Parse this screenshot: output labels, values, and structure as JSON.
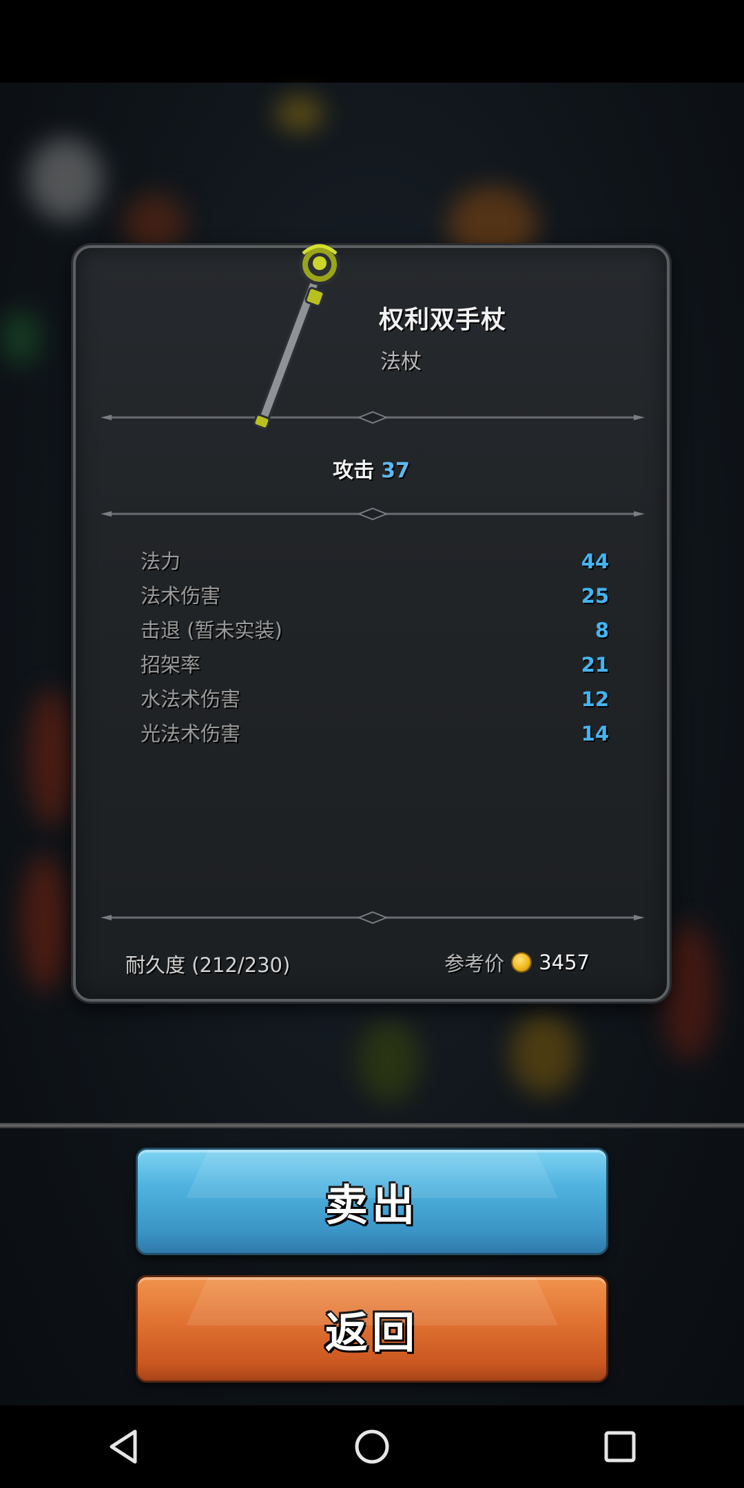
{
  "item": {
    "name": "权利双手杖",
    "type": "法杖",
    "attack_label": "攻击",
    "attack_value": "37",
    "stats": [
      {
        "name": "法力",
        "value": "44"
      },
      {
        "name": "法术伤害",
        "value": "25"
      },
      {
        "name": "击退 (暂未实装)",
        "value": "8"
      },
      {
        "name": "招架率",
        "value": "21"
      },
      {
        "name": "水法术伤害",
        "value": "12"
      },
      {
        "name": "光法术伤害",
        "value": "14"
      }
    ],
    "durability": "耐久度 (212/230)",
    "price_label": "参考价",
    "price_value": "3457"
  },
  "buttons": {
    "sell_label": "卖出",
    "back_label": "返回"
  },
  "icons": {
    "item": "golden-staff-icon",
    "currency": "gold-coin-icon",
    "nav_back": "triangle-back-icon",
    "nav_home": "circle-home-icon",
    "nav_recents": "square-recents-icon"
  },
  "colors": {
    "stat_value": "#44b4f0",
    "sell_button": "#4fb3df",
    "back_button": "#e27434"
  }
}
